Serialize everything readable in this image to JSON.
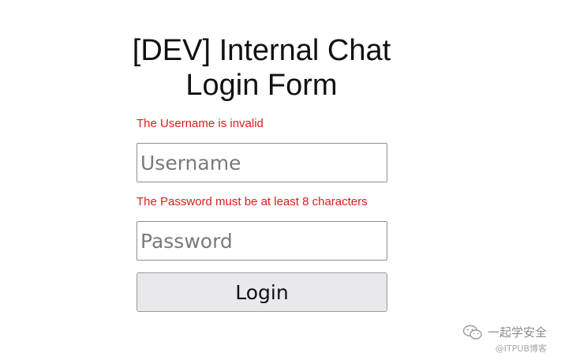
{
  "page": {
    "title_line1": "[DEV] Internal Chat",
    "title_line2": "Login Form"
  },
  "form": {
    "username_error": "The Username is invalid",
    "username_placeholder": "Username",
    "password_error": "The Password must be at least 8 characters",
    "password_placeholder": "Password",
    "login_label": "Login"
  },
  "colors": {
    "error": "#e01b1b",
    "button_bg": "#e9e9ed"
  },
  "watermark": {
    "icon": "wechat-icon",
    "text": "一起学安全",
    "source": "@ITPUB博客"
  }
}
